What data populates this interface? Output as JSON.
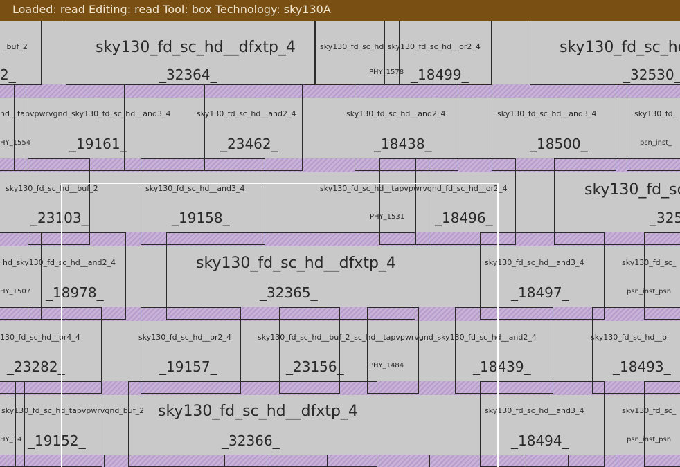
{
  "titlebar": {
    "text": "Loaded: read Editing: read Tool: box  Technology: sky130A"
  },
  "labels": {
    "buf2": "_buf_2",
    "dfxtp4": "sky130_fd_sc_hd__dfxtp_4",
    "n32364": "_32364_",
    "overlap1": "sky130_fd_sc_hd_sky130_fd_sc_hd__or2_4",
    "phy1578": "PHY_1578",
    "n18499": "_18499_",
    "sky_hd": "sky130_fd_sc_hd",
    "n32530": "_32530_",
    "n2": "2_",
    "tap_and3": "hd__tapvpwrvgnd_sky130_fd_sc_hd__and3_4",
    "phy1554": "HY_1554",
    "n19161": "_19161_",
    "and2_4": "sky130_fd_sc_hd__and2_4",
    "n23462": "_23462_",
    "n18438": "_18438_",
    "and3_4": "sky130_fd_sc_hd__and3_4",
    "n18500": "_18500_",
    "sky_fd": "sky130_fd_",
    "psn_inst": "psn_inst_",
    "buf_2full": "sky130_fd_sc_hd__buf_2",
    "n23103": "_23103_",
    "n19158": "_19158_",
    "tap_or2": "sky130_fd_sc_hd__tapvpwrvgnd_fd_sc_hd__or2_4",
    "phy1531": "PHY_1531",
    "n18496": "_18496_",
    "sky_sc": "sky130_fd_sc",
    "n325": "_325",
    "hd_tap_and2": "hd_sky130_fd_sc_hd__and2_4",
    "phy1507": "HY_1507",
    "n18978": "_18978_",
    "n32365": "_32365_",
    "n18497": "_18497_",
    "sky_fd_sc": "sky130_fd_sc_",
    "psn_inst_ps": "psn_inst_psn",
    "or4": "130_fd_sc_hd__or4_4",
    "n23282": "_23282_",
    "or2_4": "sky130_fd_sc_hd__or2_4",
    "n19157": "_19157_",
    "overlap2": "sky130_fd_sc_hd__buf_2_sc_hd__tapvpwrvgnd_sky130_fd_sc_hd__and2_4",
    "phy1484": "PHY_1484",
    "n23156": "_23156_",
    "n18439": "_18439_",
    "sky_hd_o": "sky130_fd_sc_hd__o",
    "n18493": "_18493_",
    "tap_buf": "sky130_fd_sc_hd_tapvpwrvgnd_buf_2",
    "phy14": "HY_14",
    "n19152": "_19152_",
    "n32366": "_32366_",
    "n18494": "_18494_"
  }
}
